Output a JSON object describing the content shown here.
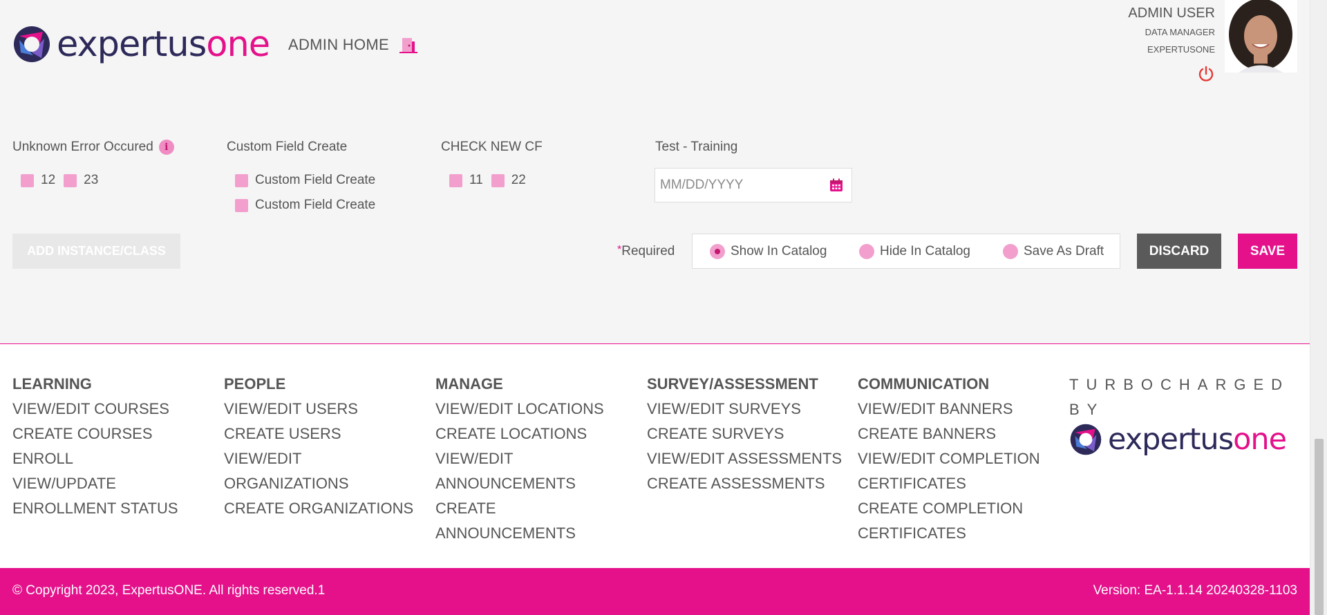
{
  "header": {
    "brand_main": "expertus",
    "brand_accent": "one",
    "nav_home": "ADMIN HOME",
    "user": {
      "name": "ADMIN USER",
      "role": "DATA MANAGER",
      "org": "EXPERTUSONE"
    }
  },
  "fields": {
    "unknown_error": {
      "label": "Unknown Error Occured",
      "options": [
        "12",
        "23"
      ]
    },
    "custom_field_create": {
      "label": "Custom Field Create",
      "options": [
        "Custom Field Create",
        "Custom Field Create"
      ]
    },
    "check_new_cf": {
      "label": "CHECK NEW CF",
      "options": [
        "11",
        "22"
      ]
    },
    "test_training": {
      "label": "Test - Training",
      "placeholder": "MM/DD/YYYY"
    }
  },
  "actions": {
    "add_instance": "ADD INSTANCE/CLASS",
    "required_mark": "*",
    "required_label": "Required",
    "visibility_options": [
      "Show In Catalog",
      "Hide In Catalog",
      "Save As Draft"
    ],
    "visibility_selected": "Show In Catalog",
    "discard": "DISCARD",
    "save": "SAVE"
  },
  "footer_nav": [
    {
      "title": "LEARNING",
      "links": [
        "VIEW/EDIT COURSES",
        "CREATE COURSES",
        "ENROLL",
        "VIEW/UPDATE",
        "ENROLLMENT STATUS"
      ]
    },
    {
      "title": "PEOPLE",
      "links": [
        "VIEW/EDIT USERS",
        "CREATE USERS",
        "VIEW/EDIT",
        "ORGANIZATIONS",
        "CREATE ORGANIZATIONS"
      ]
    },
    {
      "title": "MANAGE",
      "links": [
        "VIEW/EDIT LOCATIONS",
        "CREATE LOCATIONS",
        "VIEW/EDIT",
        "ANNOUNCEMENTS",
        "CREATE ANNOUNCEMENTS"
      ]
    },
    {
      "title": "SURVEY/ASSESSMENT",
      "links": [
        "VIEW/EDIT SURVEYS",
        "CREATE SURVEYS",
        "VIEW/EDIT ASSESSMENTS",
        "CREATE ASSESSMENTS"
      ]
    },
    {
      "title": "COMMUNICATION",
      "links": [
        "VIEW/EDIT BANNERS",
        "CREATE BANNERS",
        "VIEW/EDIT COMPLETION",
        "CERTIFICATES",
        "CREATE COMPLETION",
        "CERTIFICATES"
      ]
    }
  ],
  "turbo": {
    "line1": "TURBOCHARGED",
    "line2": "BY"
  },
  "bottom": {
    "copyright": "© Copyright 2023, ExpertusONE. All rights reserved.1",
    "version": "Version: EA-1.1.14 20240328-1103"
  },
  "colors": {
    "accent": "#e4118b",
    "navy": "#2d2a5a",
    "checkbox": "#f29fce",
    "discard": "#5a5a5a"
  }
}
